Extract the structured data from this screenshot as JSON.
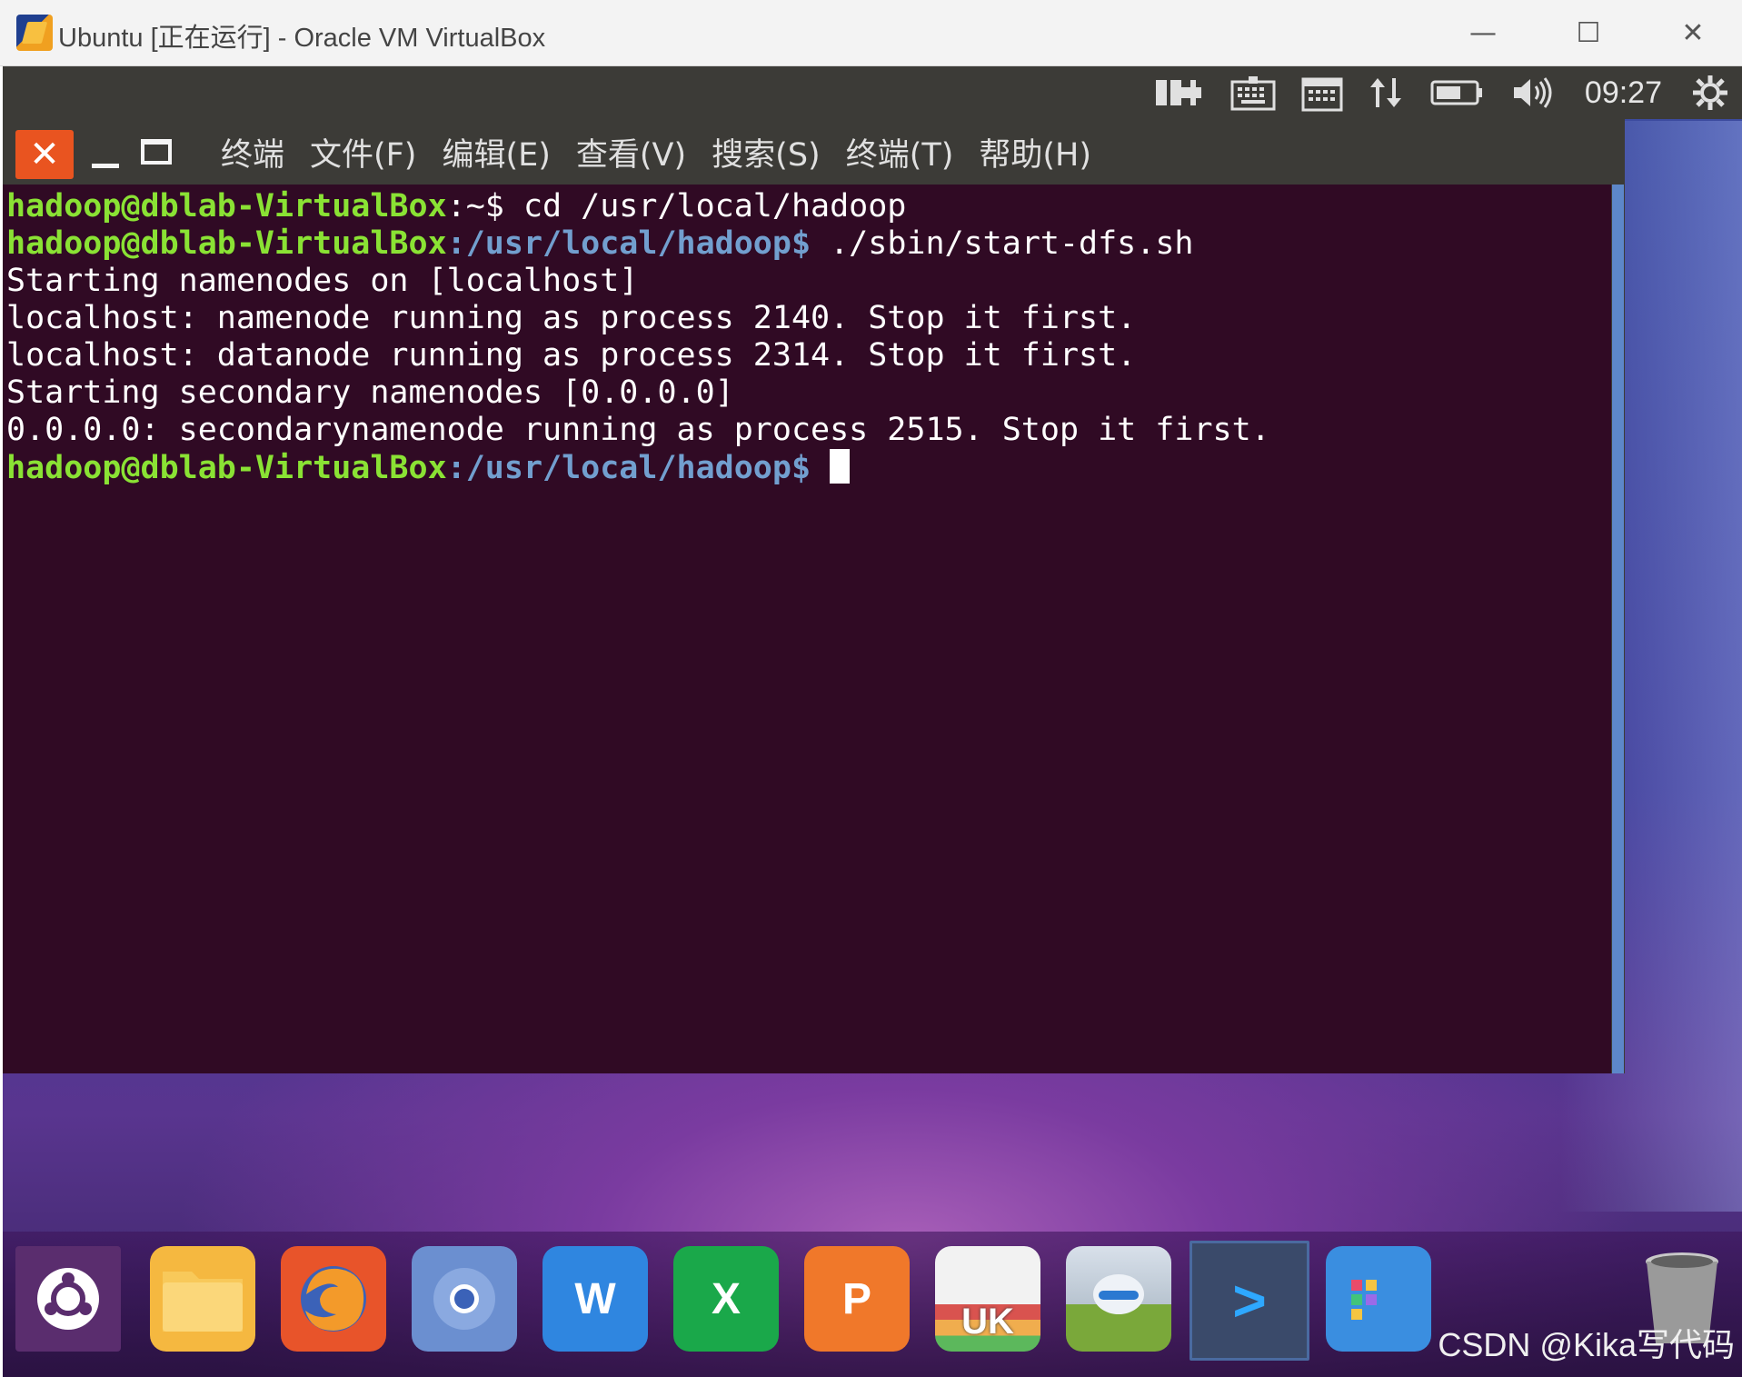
{
  "host_window": {
    "title": "Ubuntu [正在运行] - Oracle VM VirtualBox",
    "minimize_glyph": "—",
    "maximize_glyph": "☐",
    "close_glyph": "✕"
  },
  "top_panel": {
    "indicators": [
      "network-icon",
      "keyboard-icon",
      "calendar-icon",
      "transfer-arrows-icon",
      "battery-icon",
      "volume-icon"
    ],
    "clock": "09:27",
    "settings_icon": "gear-icon"
  },
  "terminal": {
    "menu": [
      "终端",
      "文件(F)",
      "编辑(E)",
      "查看(V)",
      "搜索(S)",
      "终端(T)",
      "帮助(H)"
    ],
    "lines": [
      {
        "user": "hadoop@dblab-VirtualBox",
        "path": ":~$",
        "cmd": " cd /usr/local/hadoop"
      },
      {
        "user": "hadoop@dblab-VirtualBox",
        "path": ":/usr/local/hadoop$",
        "cmd": " ./sbin/start-dfs.sh"
      },
      {
        "text": "Starting namenodes on [localhost]"
      },
      {
        "text": "localhost: namenode running as process 2140. Stop it first."
      },
      {
        "text": "localhost: datanode running as process 2314. Stop it first."
      },
      {
        "text": "Starting secondary namenodes [0.0.0.0]"
      },
      {
        "text": "0.0.0.0: secondarynamenode running as process 2515. Stop it first."
      },
      {
        "user": "hadoop@dblab-VirtualBox",
        "path": ":/usr/local/hadoop$",
        "cmd": " ",
        "cursor": true
      }
    ]
  },
  "dock": {
    "items": [
      {
        "name": "ubuntu-dash-icon",
        "color": "#5a2d6e"
      },
      {
        "name": "files-folder-icon",
        "color": "#f5b840"
      },
      {
        "name": "firefox-icon",
        "color": "#e8542a"
      },
      {
        "name": "chromium-icon",
        "color": "#6b8fd0"
      },
      {
        "name": "word-icon",
        "color": "#2f86e0",
        "glyph": "W"
      },
      {
        "name": "excel-icon",
        "color": "#1aa84a",
        "glyph": "X"
      },
      {
        "name": "powerpoint-icon",
        "color": "#f0782a",
        "glyph": "P"
      },
      {
        "name": "software-center-icon",
        "color": "#e8e8e8",
        "glyph": "UK"
      },
      {
        "name": "robot-app-icon",
        "color": "#7aa83a"
      },
      {
        "name": "terminal-icon",
        "color": "#3a4a6a",
        "glyph": ">"
      },
      {
        "name": "app-grid-icon",
        "color": "#3a8ee0"
      }
    ],
    "trash_icon": "trash-icon"
  },
  "watermark": "CSDN @Kika写代码"
}
